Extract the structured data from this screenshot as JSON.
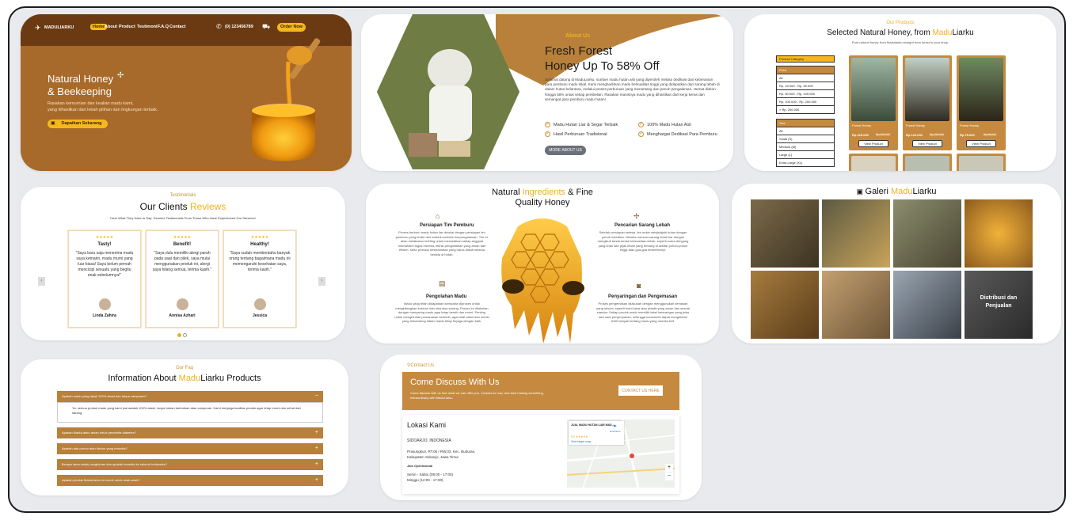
{
  "hero": {
    "brand": "MADULIARKU",
    "nav": [
      "Home",
      "About",
      "Product",
      "Testimoni",
      "F.A.Q",
      "Contact"
    ],
    "phone": "(0) 123456789",
    "order_btn": "Order Now",
    "title_line1": "Natural Honey",
    "title_line2": "& Beekeeping",
    "desc_line1": "Rasakan kemurnian dan kealian madu kami,",
    "desc_line2": "yang dihasilkan dari lebah pilihan dan lingkungan terbaik.",
    "cta": "Dapatkan Sekarang"
  },
  "about": {
    "kicker": "About Us",
    "title_line1": "Fresh Forest",
    "title_line2": "Honey Up To 58% Off",
    "body": "Selamat datang di MaduLiarku, sumber madu hutan asli yang diperoleh melalui dedikasi dan keberanian para pemburu madu lokal. Kami menghadirkan madu berkualitas tinggi yang didapatkan dari sarang lebah di dalam hutan belantara, melalui proses perburuan yang menantang dan penuh pengalaman. Hemat diskon hingga 58% untuk setiap pembelian. Rasakan manisnya madu yang dihasilkan dari kerja keras dan semangat para pemburu madu hutan!",
    "checks": [
      "Madu Hutan Liar & Segar Terbaik",
      "100% Madu Hutan Asli",
      "Hasil Perburuan Tradisional",
      "Menghargai Dedikasi Para Pemburu"
    ],
    "button": "MORE ABOUT US"
  },
  "products": {
    "kicker": "Our Products",
    "title_a": "Selected Natural Honey, from ",
    "title_b": "Madu",
    "title_c": "Liarku",
    "subtitle": "Pure natural honey from Maduliarku straight from forest to your shop.",
    "filter_btn": "Product Category",
    "cat_head": "Price",
    "cats": [
      "All",
      "Rp. 15.000 - Rp. 50.000",
      "Rp. 50.000 - Rp. 100.000",
      "Rp. 100.000 - Rp. 200.000",
      "> Rp. 200.000"
    ],
    "size_head": "Size",
    "sizes": [
      "All",
      "Small (S)",
      "Medium (M)",
      "Large (L)",
      "Extra Large (XL)"
    ],
    "items": [
      {
        "name": "Forest Honey",
        "price": "Rp.225.000",
        "old": "Rp.250.000",
        "btn": "View Product"
      },
      {
        "name": "Forest Honey",
        "price": "Rp.120.000",
        "old": "Rp.150.000",
        "btn": "View Product"
      },
      {
        "name": "Forest Honey",
        "price": "Rp.75.000",
        "old": "Rp.95.000",
        "btn": "View Product"
      }
    ]
  },
  "testimonials": {
    "kicker": "Testimonials",
    "title_a": "Our Clients ",
    "title_b": "Reviews",
    "subtitle": "Hear What They Have to Say: Genuine Testimonials From Those Who Have Experienced Our Services!",
    "cards": [
      {
        "stars": "★★★★★",
        "head": "Tasty!",
        "quote": "\"Saya baru saja menerima madu saya kemarin, madu murni yang luar biasa! Saya belum pernah mencicipi sesuatu yang begitu enak sebelumnya!\"",
        "name": "Linda Zahira"
      },
      {
        "stars": "★★★★★",
        "head": "Benefit!",
        "quote": "\"Saya dulu memiliki alergi parah pada saat dan pilek, saya mulai menggunakan produk ini, alergi saya hilang semua, terima kasih.\"",
        "name": "Annisa Azhari"
      },
      {
        "stars": "★★★★★",
        "head": "Healthy!",
        "quote": "\"Saya sudah membentahu banyak orang tentang bagaimana madu ini memengaruhi kesehatan saya, terima kasih.\"",
        "name": "Jessica"
      }
    ]
  },
  "ingredients": {
    "title_a": "Natural ",
    "title_b": "Ingredients",
    "title_c": " & Fine",
    "title_line2": "Quality Honey",
    "items": [
      {
        "head": "Persiapan Tim Pemburu",
        "text": "Proses berburu madu hutan liar dimulai dengan persiapan tim pemburu yang terdiri dari individu-individu berpengalaman. Tim ini akan melakukan briefing untuk memastikan setiap anggota memahami tugas mereka, teknik pengambilan yang aman dan efisien, serta protokol keselamatan yang harus diikuti selama berada di hutan."
      },
      {
        "head": "Pencarian Sarang Lebah",
        "text": "Setelah persiapan selesai, tim mulai menjelajahi hutan dengan penuh ketelitian. Mereka mencari sarang lebah liar dengan mengikuti tanda-tanda keberadaan lebah, seperti suara dengung yang khas dan jejak lebah yang terbang di sekitar pohon-pohon tinggi atau gua-gua tersembunyi."
      },
      {
        "head": "Pengolahan Madu",
        "text": "Madu yang telah didapatkan kemudian diproses untuk menghilangkan kotoran dan sisa-sisa sarang. Proses ini dilakukan dengan menyaring madu agar tetap bersih dan murni. Penting untuk menghindari pemanasan berlebih, agar sifat alami dan nutrisi yang terkandung dalam madu tetap terjaga dengan baik."
      },
      {
        "head": "Penyaringan dan Pengemasan",
        "text": "Proses pengemasan dilakukan dengan menggunakan kemasan yang sesuai, seperti botol kaca atau plastik yang aman dan sesuai standar. Setiap produk madu memiliki label keterangan yang jelas dan cara penyimpanan, sehingga konsumen dapat mengetahui lebih banyak tentang madu yang mereka beli."
      }
    ]
  },
  "gallery": {
    "icon": "image-icon",
    "title_a": "Galeri ",
    "title_b": "Madu",
    "title_c": "Liarku",
    "overlay": "Distribusi dan Penjualan"
  },
  "faq": {
    "kicker": "Our Faq",
    "title_a": "Information About ",
    "title_b": "Madu",
    "title_c": "Liarku Products",
    "open_q": "Apakah madu yang dijual 100% alami dan tanpa campuran?",
    "open_a": "Ya, semua produk madu yang kami jual adalah 100% alami, tanpa bahan tambahan atau campuran. Kami menjaga kualitas produk agar tetap murni dan sehat dari sarang.",
    "questions": [
      "Apakah MaduLiarku aman untuk penderita diabetes?",
      "Apakah ada promo atau diskon yang tersedia?",
      "Berapa lama waktu pengiriman dan apakah tersedia ke seluruh Indonesia?",
      "Apakah produk MaduLiarku ini cocok untuk anak-anak?"
    ]
  },
  "contact": {
    "kicker": "Contact Us",
    "title": "Come Discuss With Us",
    "desc": "Come discuss with us See what we can offer you. Contact us now, and start making something extraordinary with MaduLiarku",
    "btn": "CONTACT US HERE",
    "loc_title": "Lokasi Kami",
    "city": "SIDOARJO, INDONESIA",
    "addr1": "Prasungkuri, RT.06 / RW.03, Kec. Buduran,",
    "addr2": "Kabupaten Sidoarjo, Jawa Timur",
    "hours_head": "Jam Operasional",
    "hours1": "Senin - Sabtu (09:00 - 17:00)",
    "hours2": "Minggu (12:00 - 17:00)",
    "map_place": "JUAL MADU HUTAN LIAR MAD...",
    "map_rating": "5.0 ★★★★★",
    "map_link": "View larger map",
    "map_dir": "Directions"
  },
  "colors": {
    "brown": "#a86a2a",
    "dark": "#6b3a12",
    "gold": "#e9b31c",
    "card_brown": "#c58a3f"
  }
}
